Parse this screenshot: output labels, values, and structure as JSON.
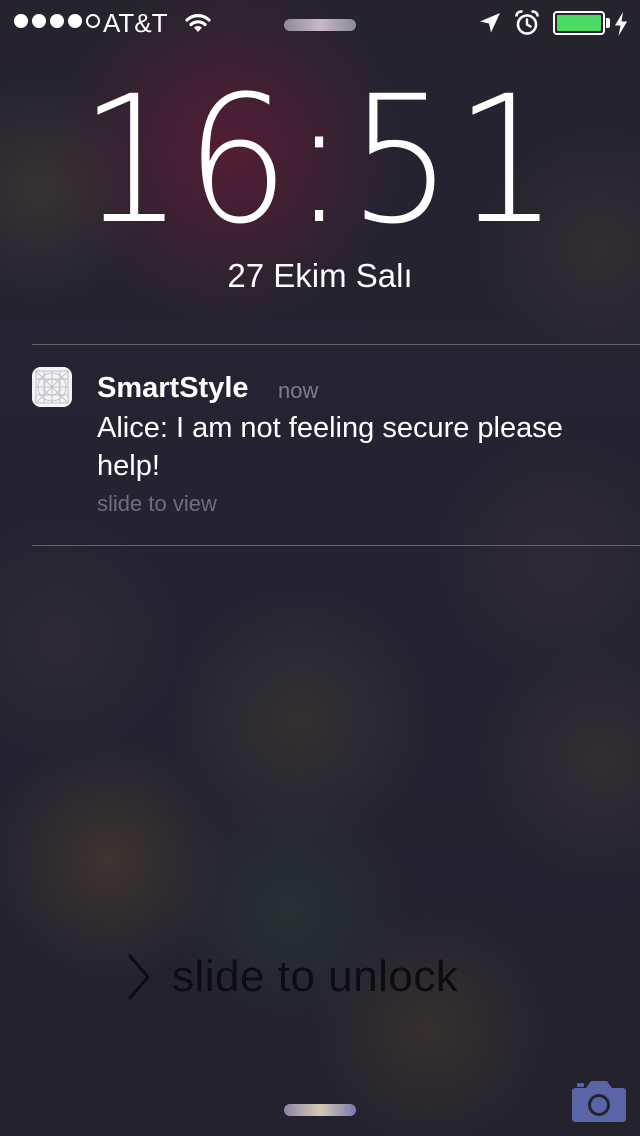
{
  "status_bar": {
    "signal_strength": {
      "filled": 4,
      "total": 5
    },
    "carrier": "AT&T",
    "wifi_icon": "wifi-icon",
    "location_icon": "location-arrow-icon",
    "alarm_icon": "alarm-clock-icon",
    "battery_level": 1.0,
    "battery_color": "#4cd964",
    "charging_icon": "lightning-bolt-icon"
  },
  "lock_screen": {
    "time": "16:51",
    "date": "27 Ekim Salı"
  },
  "notification": {
    "app_icon": "grid-app-icon",
    "app_name": "SmartStyle",
    "time_ago": "now",
    "message": "Alice: I am not feeling secure please help!",
    "hint": "slide to view"
  },
  "unlock": {
    "chevron_icon": "chevron-right-icon",
    "label": "slide to unlock"
  },
  "camera": {
    "icon": "camera-icon",
    "color": "#5b64a6"
  }
}
